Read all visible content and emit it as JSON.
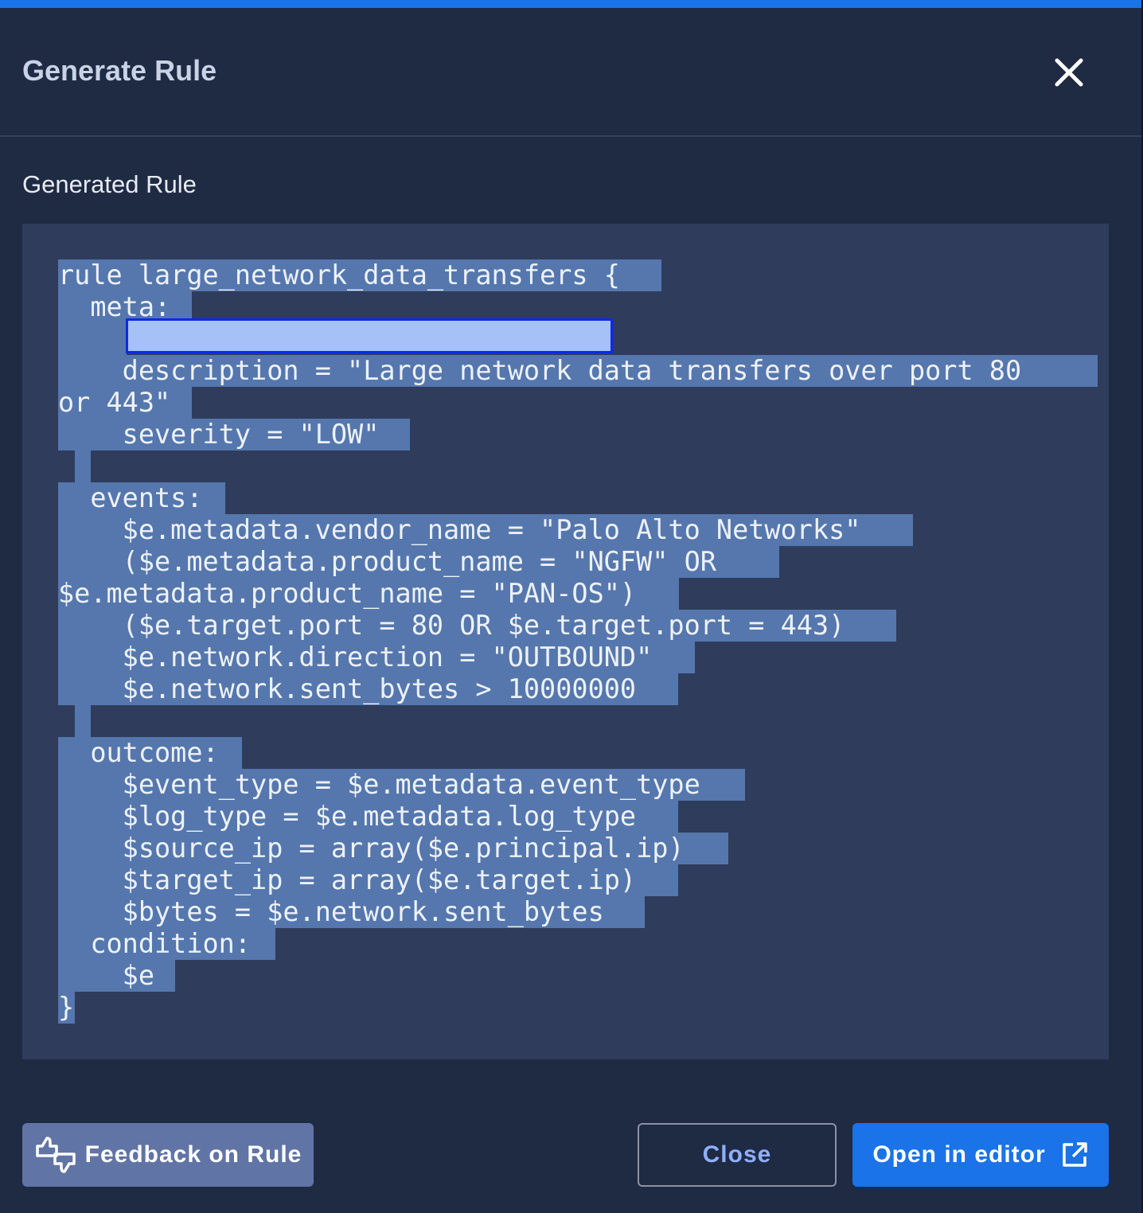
{
  "dialog": {
    "title": "Generate Rule",
    "section_label": "Generated Rule"
  },
  "code": {
    "lines": [
      "rule large_network_data_transfers {",
      "  meta:",
      "",
      "    description = \"Large network data transfers over port 80",
      "or 443\"",
      "    severity = \"LOW\"",
      "",
      "  events:",
      "    $e.metadata.vendor_name = \"Palo Alto Networks\"",
      "    ($e.metadata.product_name = \"NGFW\" OR",
      "$e.metadata.product_name = \"PAN-OS\")",
      "    ($e.target.port = 80 OR $e.target.port = 443)",
      "    $e.network.direction = \"OUTBOUND\"",
      "    $e.network.sent_bytes > 10000000",
      "",
      "  outcome:",
      "    $event_type = $e.metadata.event_type",
      "    $log_type = $e.metadata.log_type",
      "    $source_ip = array($e.principal.ip)",
      "    $target_ip = array($e.target.ip)",
      "    $bytes = $e.network.sent_bytes",
      "  condition:",
      "    $e",
      "}"
    ]
  },
  "buttons": {
    "feedback": "Feedback on Rule",
    "close": "Close",
    "open_editor": "Open in editor"
  },
  "icons": {
    "close": "close-icon",
    "feedback": "thumbs-feedback-icon",
    "open_editor": "external-link-icon"
  },
  "colors": {
    "accent": "#1a73e8",
    "background": "#1f2a43",
    "code_background": "#2f3c5c",
    "selection": "#5577ad"
  }
}
